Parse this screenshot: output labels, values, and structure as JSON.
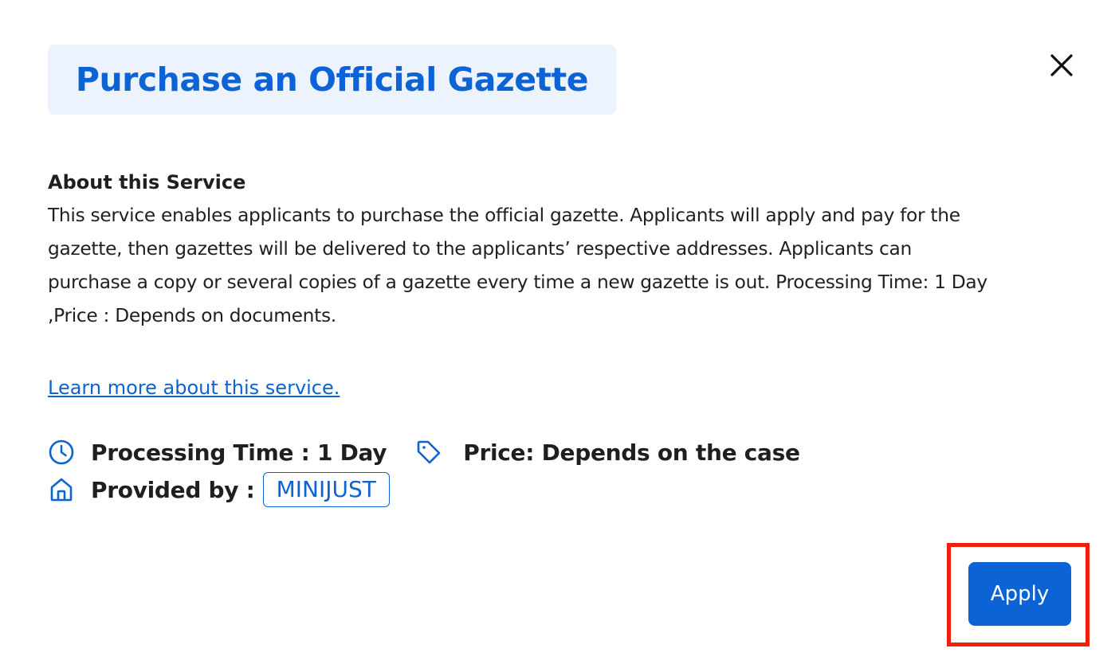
{
  "dialog": {
    "title": "Purchase an Official Gazette",
    "close_icon": "close-icon"
  },
  "about": {
    "heading": "About this Service",
    "body": "This service enables applicants to purchase the official gazette. Applicants will apply and pay for the\ngazette, then gazettes will be delivered to the applicants’ respective addresses. Applicants can\npurchase a copy or several copies of a gazette every time a new gazette is out. Processing Time: 1 Day\n,Price : Depends on documents.",
    "learn_more": "Learn more about this service."
  },
  "details": {
    "processing_time": "Processing Time : 1 Day",
    "processing_icon": "clock-icon",
    "price": "Price: Depends on the case",
    "price_icon": "tag-icon",
    "provided_by_label": "Provided by :",
    "provider_icon": "home-icon",
    "provider": "MINIJUST"
  },
  "actions": {
    "apply_label": "Apply"
  },
  "colors": {
    "accent": "#0b63d6",
    "title_background": "#edf3fc",
    "highlight": "#f21e0a",
    "text": "#1f1f1f"
  }
}
